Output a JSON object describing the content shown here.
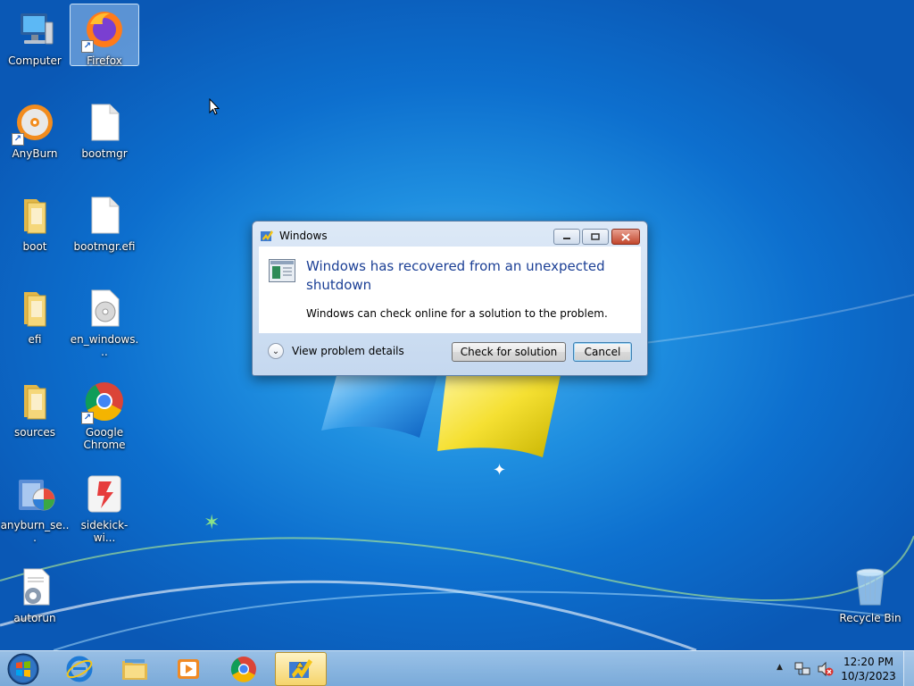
{
  "desktop": {
    "icons": [
      {
        "label": "Computer",
        "icon": "computer-icon"
      },
      {
        "label": "Firefox",
        "icon": "firefox-icon"
      },
      {
        "label": "AnyBurn",
        "icon": "anyburn-icon"
      },
      {
        "label": "bootmgr",
        "icon": "file-icon"
      },
      {
        "label": "boot",
        "icon": "folder-icon"
      },
      {
        "label": "bootmgr.efi",
        "icon": "file-icon"
      },
      {
        "label": "efi",
        "icon": "folder-icon"
      },
      {
        "label": "en_windows...",
        "icon": "disc-image-icon"
      },
      {
        "label": "sources",
        "icon": "folder-icon"
      },
      {
        "label": "Google Chrome",
        "icon": "chrome-icon"
      },
      {
        "label": "anyburn_se...",
        "icon": "installer-icon"
      },
      {
        "label": "sidekick-wi...",
        "icon": "sidekick-icon"
      },
      {
        "label": "autorun",
        "icon": "autorun-config-icon"
      },
      {
        "label": "Recycle Bin",
        "icon": "recycle-bin-icon"
      }
    ]
  },
  "dialog": {
    "title": "Windows",
    "heading": "Windows has recovered from an unexpected shutdown",
    "message": "Windows can check online for a solution to the problem.",
    "details_label": "View problem details",
    "check_button": "Check for solution",
    "cancel_button": "Cancel"
  },
  "taskbar": {
    "pinned": [
      "internet-explorer-icon",
      "file-explorer-icon",
      "media-player-icon",
      "chrome-icon",
      "problem-reports-icon"
    ],
    "active_index": 4,
    "clock": {
      "time": "12:20 PM",
      "date": "10/3/2023"
    }
  },
  "colors": {
    "dialog_heading": "#1b3f95",
    "desktop_bg": "#0d6fce"
  }
}
